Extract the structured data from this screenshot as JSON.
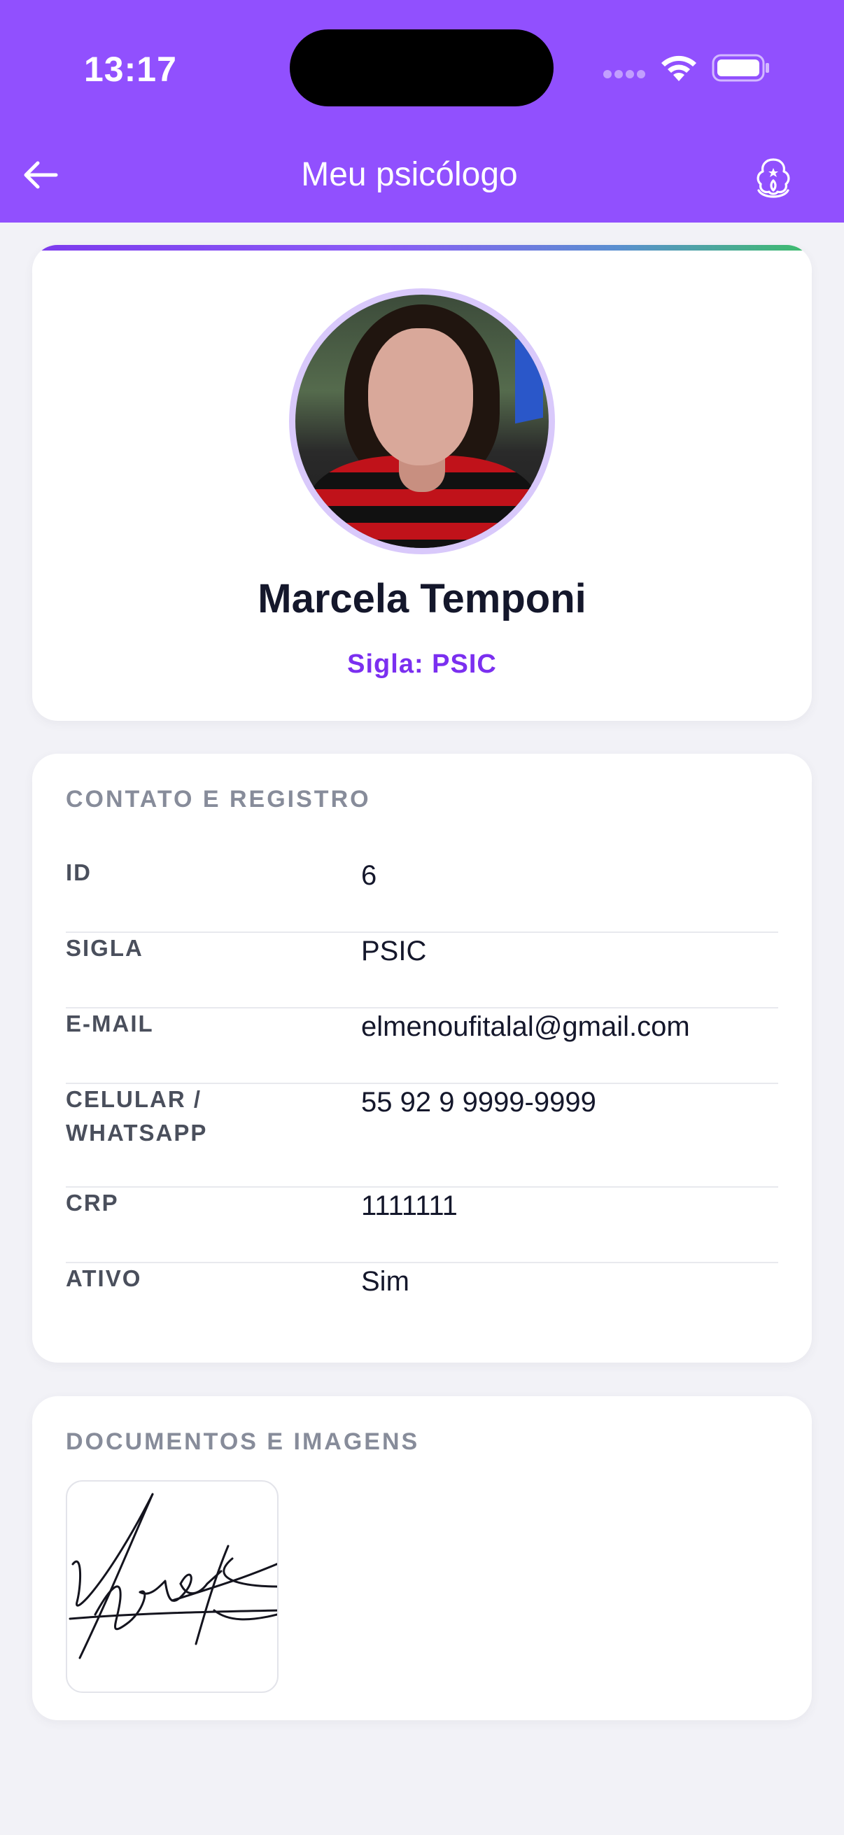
{
  "status_bar": {
    "time": "13:17",
    "icons": [
      "signal-icon",
      "wifi-icon",
      "battery-icon"
    ]
  },
  "header": {
    "title": "Meu psicólogo",
    "back_icon": "arrow-left-icon",
    "brand_icon": "lotus-mind-icon",
    "background_color": "#9150fe"
  },
  "profile": {
    "name": "Marcela Temponi",
    "sigla": "Sigla: PSIC",
    "accent_color": "#7b2ff0"
  },
  "contact": {
    "title": "CONTATO E REGISTRO",
    "rows": [
      {
        "label": "ID",
        "value": "6"
      },
      {
        "label": "SIGLA",
        "value": "PSIC"
      },
      {
        "label": "E-MAIL",
        "value": "elmenoufitalal@gmail.com"
      },
      {
        "label": "CELULAR / WHATSAPP",
        "value": "55 92 9 9999-9999"
      },
      {
        "label": "CRP",
        "value": "1111111"
      },
      {
        "label": "ATIVO",
        "value": "Sim"
      }
    ]
  },
  "documents": {
    "title": "DOCUMENTOS E IMAGENS",
    "items": [
      {
        "type": "signature-image"
      }
    ]
  }
}
